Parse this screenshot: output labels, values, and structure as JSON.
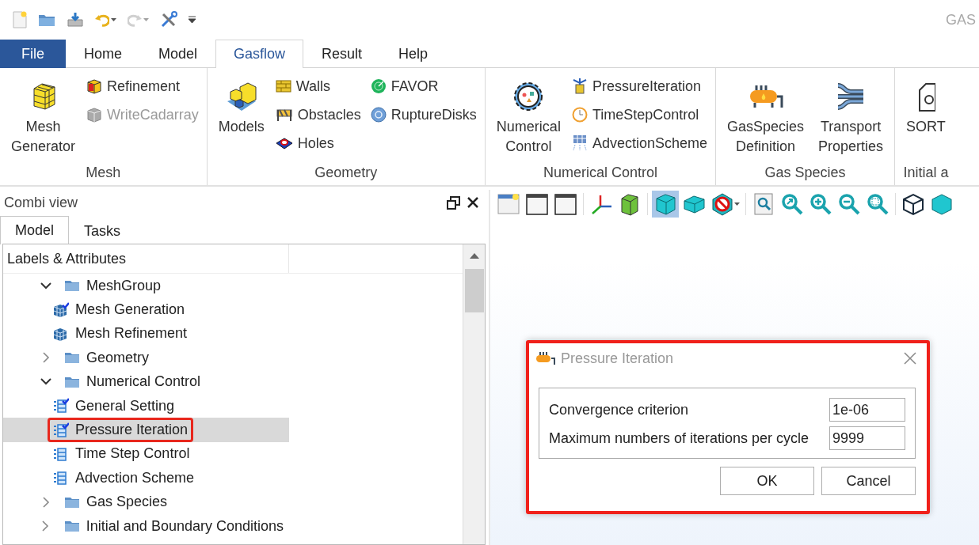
{
  "window": {
    "title": "GAS"
  },
  "quick_access": [
    {
      "disabled": false
    },
    {
      "disabled": false
    },
    {
      "disabled": false
    },
    {
      "disabled": false
    },
    {
      "disabled": true
    },
    {
      "disabled": false
    }
  ],
  "menu_tabs": [
    {
      "label": "File",
      "kind": "file",
      "selected": false
    },
    {
      "label": "Home",
      "kind": "tab",
      "selected": false
    },
    {
      "label": "Model",
      "kind": "tab",
      "selected": false
    },
    {
      "label": "Gasflow",
      "kind": "tab",
      "selected": true
    },
    {
      "label": "Result",
      "kind": "tab",
      "selected": false
    },
    {
      "label": "Help",
      "kind": "tab",
      "selected": false
    }
  ],
  "ribbon": {
    "groups": [
      {
        "label": "Mesh",
        "items": [
          {
            "label": "Mesh Generator",
            "kind": "large",
            "disabled": false
          },
          {
            "label": "Refinement",
            "kind": "small",
            "disabled": false
          },
          {
            "label": "WriteCadarray",
            "kind": "small",
            "disabled": true
          }
        ]
      },
      {
        "label": "Geometry",
        "items": [
          {
            "label": "Models",
            "kind": "large",
            "disabled": false
          },
          {
            "label": "Walls",
            "kind": "small",
            "disabled": false
          },
          {
            "label": "Obstacles",
            "kind": "small",
            "disabled": false
          },
          {
            "label": "Holes",
            "kind": "small",
            "disabled": false
          },
          {
            "label": "FAVOR",
            "kind": "small",
            "disabled": false
          },
          {
            "label": "RuptureDisks",
            "kind": "small",
            "disabled": false
          }
        ]
      },
      {
        "label": "Numerical Control",
        "items": [
          {
            "label": "Numerical Control",
            "kind": "large",
            "disabled": false
          },
          {
            "label": "PressureIteration",
            "kind": "small",
            "disabled": false
          },
          {
            "label": "TimeStepControl",
            "kind": "small",
            "disabled": false
          },
          {
            "label": "AdvectionScheme",
            "kind": "small",
            "disabled": false
          }
        ]
      },
      {
        "label": "Gas Species",
        "items": [
          {
            "label": "GasSpecies Definition",
            "kind": "large",
            "disabled": false
          },
          {
            "label": "Transport Properties",
            "kind": "large",
            "disabled": false
          }
        ]
      },
      {
        "label": "Initial a",
        "items": [
          {
            "label": "SORT",
            "kind": "large",
            "disabled": false
          }
        ]
      }
    ]
  },
  "combi_view": {
    "title": "Combi view",
    "tabs": [
      {
        "label": "Model",
        "selected": true
      },
      {
        "label": "Tasks",
        "selected": false
      }
    ],
    "tree": {
      "header": "Labels & Attributes",
      "items": [
        {
          "label": "MeshGroup",
          "expanded": true,
          "children": [
            {
              "label": "Mesh Generation",
              "kind": "mesh",
              "checked": true,
              "selected": false,
              "highlighted": false
            },
            {
              "label": "Mesh Refinement",
              "kind": "mesh",
              "checked": false,
              "selected": false,
              "highlighted": false
            }
          ]
        },
        {
          "label": "Geometry",
          "expanded": false
        },
        {
          "label": "Numerical Control",
          "expanded": true,
          "children": [
            {
              "label": "General Setting",
              "kind": "setting",
              "checked": true,
              "selected": false,
              "highlighted": false
            },
            {
              "label": "Pressure Iteration",
              "kind": "setting",
              "checked": true,
              "selected": true,
              "highlighted": true
            },
            {
              "label": "Time Step Control",
              "kind": "setting",
              "checked": false,
              "selected": false,
              "highlighted": false
            },
            {
              "label": "Advection Scheme",
              "kind": "setting",
              "checked": false,
              "selected": false,
              "highlighted": false
            }
          ]
        },
        {
          "label": "Gas Species",
          "expanded": false
        },
        {
          "label": "Initial and Boundary Conditions",
          "expanded": false
        }
      ]
    }
  },
  "view_toolbar": [
    {
      "selected": false
    },
    {
      "selected": false
    },
    {
      "selected": false
    },
    {
      "selected": false
    },
    {
      "selected": false
    },
    {
      "selected": true
    },
    {
      "selected": false
    },
    {
      "selected": false
    },
    {
      "selected": false
    },
    {
      "selected": false
    },
    {
      "selected": false
    },
    {
      "selected": false
    },
    {
      "selected": false
    },
    {
      "selected": false
    },
    {
      "selected": false
    }
  ],
  "dialog": {
    "title": "Pressure Iteration",
    "highlighted": true,
    "fields": [
      {
        "label": "Convergence criterion",
        "value": "1e-06"
      },
      {
        "label": "Maximum numbers of iterations per cycle",
        "value": "9999"
      }
    ],
    "buttons": [
      "OK",
      "Cancel"
    ]
  }
}
